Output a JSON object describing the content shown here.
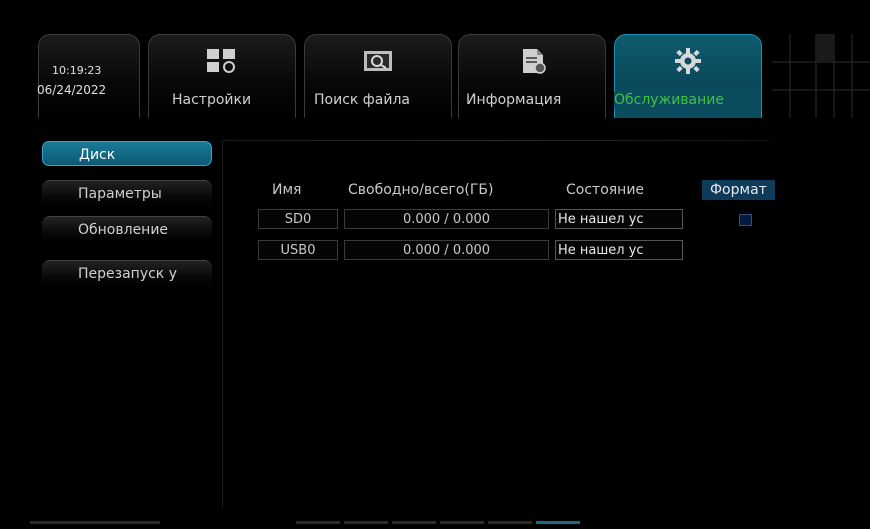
{
  "clock": {
    "time": "10:19:23",
    "date": "06/24/2022"
  },
  "tabs": [
    {
      "label": "Настройки",
      "icon": "settings-grid-icon",
      "active": false
    },
    {
      "label": "Поиск файла",
      "icon": "file-search-icon",
      "active": false
    },
    {
      "label": "Информация",
      "icon": "info-document-icon",
      "active": false
    },
    {
      "label": "Обслуживание",
      "icon": "gear-icon",
      "active": true
    }
  ],
  "sidebar": {
    "items": [
      {
        "label": "Диск",
        "active": true
      },
      {
        "label": "Параметры",
        "active": false
      },
      {
        "label": "Обновление",
        "active": false
      },
      {
        "label": "Перезапуск у",
        "active": false
      }
    ]
  },
  "disk_table": {
    "headers": {
      "name": "Имя",
      "space": "Свободно/всего(ГБ)",
      "status": "Состояние",
      "format": "Формат"
    },
    "rows": [
      {
        "name": "SD0",
        "space": "0.000 / 0.000",
        "status": "Не нашел ус",
        "format_checkbox": true
      },
      {
        "name": "USB0",
        "space": "0.000 / 0.000",
        "status": "Не нашел ус",
        "format_checkbox": false
      }
    ]
  },
  "colors": {
    "accent": "#0b4d5f",
    "active_label": "#40c040",
    "sidebar_active": "#1a7a98",
    "format_header": "#0e3b5a"
  }
}
